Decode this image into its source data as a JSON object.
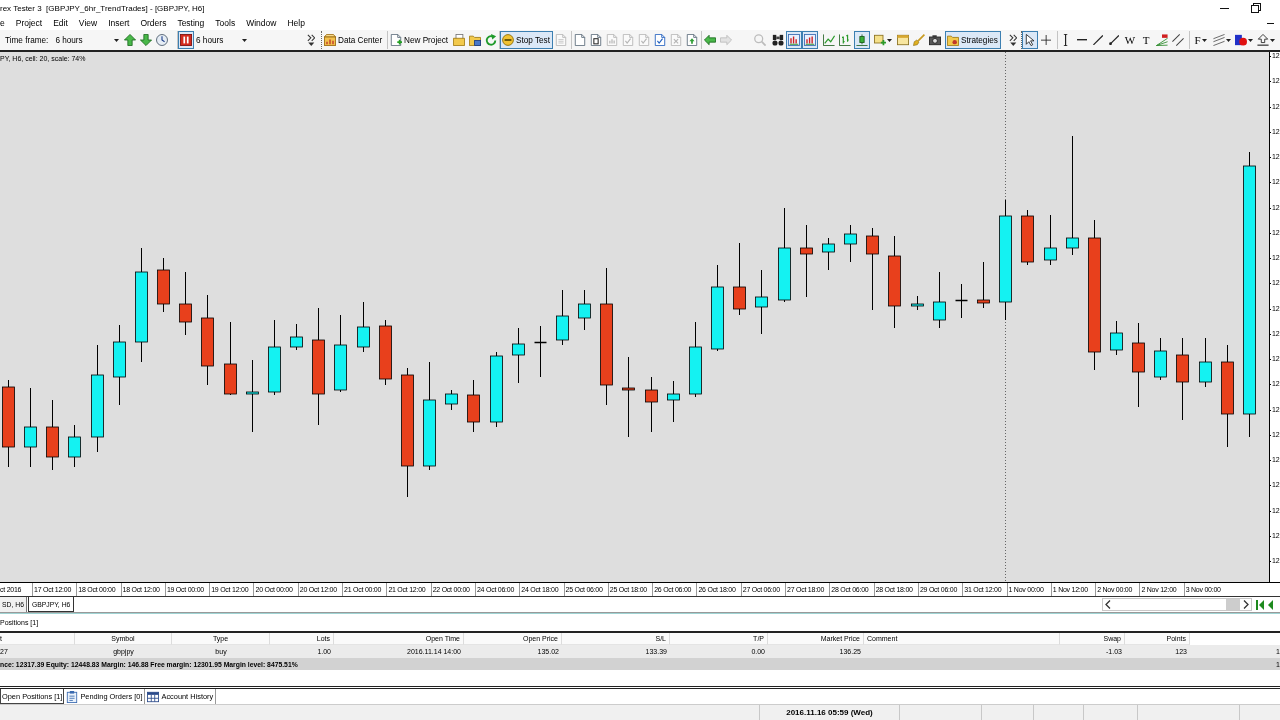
{
  "window": {
    "title": "rex Tester 3  [GBPJPY_6hr_TrendTrades] - [GBPJPY, H6]"
  },
  "menu": [
    "e",
    "Project",
    "Edit",
    "View",
    "Insert",
    "Orders",
    "Testing",
    "Tools",
    "Window",
    "Help"
  ],
  "toolbar": [
    [
      {
        "kind": "label",
        "text": "Time frame:"
      },
      {
        "kind": "dropdown",
        "value": "6 hours"
      },
      {
        "kind": "tool",
        "pressed": false,
        "disabled": false
      },
      {
        "kind": "tool",
        "pressed": false,
        "disabled": false
      },
      {
        "kind": "tool",
        "pressed": false,
        "disabled": false
      }
    ],
    [
      {
        "kind": "tool",
        "pressed": true,
        "disabled": false
      },
      {
        "kind": "dropdown",
        "value": "6 hours"
      }
    ],
    [
      {
        "kind": "tool",
        "pressed": false,
        "disabled": false
      }
    ],
    [
      {
        "kind": "button",
        "label": "Data Center",
        "pressed": false
      }
    ],
    [
      {
        "kind": "button",
        "label": "New Project",
        "pressed": false
      },
      {
        "kind": "tool",
        "pressed": false,
        "disabled": false
      },
      {
        "kind": "tool",
        "pressed": false,
        "disabled": false
      },
      {
        "kind": "tool",
        "pressed": false,
        "disabled": false
      }
    ],
    [
      {
        "kind": "button",
        "label": "Stop Test",
        "pressed": true
      },
      {
        "kind": "tool",
        "pressed": false,
        "disabled": true
      }
    ],
    [
      {
        "kind": "tool",
        "pressed": false,
        "disabled": false
      },
      {
        "kind": "tool",
        "pressed": false,
        "disabled": false
      },
      {
        "kind": "tool",
        "pressed": false,
        "disabled": true
      },
      {
        "kind": "tool",
        "pressed": false,
        "disabled": true
      },
      {
        "kind": "tool",
        "pressed": false,
        "disabled": true
      },
      {
        "kind": "tool",
        "pressed": false,
        "disabled": false
      },
      {
        "kind": "tool",
        "pressed": false,
        "disabled": true
      },
      {
        "kind": "tool",
        "pressed": false,
        "disabled": false
      }
    ],
    [
      {
        "kind": "tool",
        "pressed": false,
        "disabled": false
      },
      {
        "kind": "tool",
        "pressed": false,
        "disabled": true
      },
      {
        "kind": "tool",
        "pressed": false,
        "disabled": true
      },
      {
        "kind": "tool",
        "pressed": false,
        "disabled": false
      },
      {
        "kind": "tool",
        "pressed": true,
        "disabled": false
      },
      {
        "kind": "tool",
        "pressed": true,
        "disabled": false
      },
      {
        "kind": "tool",
        "pressed": false,
        "disabled": false
      },
      {
        "kind": "tool",
        "pressed": false,
        "disabled": false
      },
      {
        "kind": "tool",
        "pressed": true,
        "disabled": false
      },
      {
        "kind": "tool",
        "pressed": false,
        "disabled": false
      },
      {
        "kind": "tool",
        "pressed": false,
        "disabled": false
      },
      {
        "kind": "tool",
        "pressed": false,
        "disabled": false
      },
      {
        "kind": "tool",
        "pressed": false,
        "disabled": false
      }
    ],
    [
      {
        "kind": "button",
        "label": "Strategies",
        "pressed": true
      }
    ],
    [
      {
        "kind": "tool",
        "pressed": false,
        "disabled": false
      }
    ],
    [
      {
        "kind": "tool",
        "pressed": true,
        "disabled": false
      },
      {
        "kind": "tool",
        "pressed": false,
        "disabled": false
      }
    ],
    [
      {
        "kind": "tool",
        "pressed": false,
        "disabled": false
      },
      {
        "kind": "tool",
        "pressed": false,
        "disabled": false
      },
      {
        "kind": "tool",
        "pressed": false,
        "disabled": false
      },
      {
        "kind": "tool",
        "pressed": false,
        "disabled": false
      },
      {
        "kind": "glyph",
        "text": "W",
        "pressed": false
      },
      {
        "kind": "glyph",
        "text": "T",
        "pressed": false
      },
      {
        "kind": "tool",
        "pressed": false,
        "disabled": false
      },
      {
        "kind": "tool",
        "pressed": false,
        "disabled": false
      }
    ],
    [
      {
        "kind": "glyph",
        "text": "F",
        "pressed": false
      },
      {
        "kind": "tool",
        "pressed": false,
        "disabled": false
      },
      {
        "kind": "tool",
        "pressed": false,
        "disabled": false
      },
      {
        "kind": "tool",
        "pressed": false,
        "disabled": false
      }
    ]
  ],
  "chart": {
    "info": "PY, H6, cell: 20, scale: 74%",
    "price_axis": [
      "12",
      "12",
      "12",
      "12",
      "12",
      "12",
      "12",
      "12",
      "12",
      "12",
      "12",
      "12",
      "12",
      "12",
      "12",
      "12",
      "12",
      "12",
      "12",
      "12",
      "12"
    ],
    "time_axis": [
      "ct 2016",
      "17 Oct 12:00",
      "18 Oct 00:00",
      "18 Oct 12:00",
      "19 Oct 00:00",
      "19 Oct 12:00",
      "20 Oct 00:00",
      "20 Oct 12:00",
      "21 Oct 00:00",
      "21 Oct 12:00",
      "22 Oct 00:00",
      "24 Oct 06:00",
      "24 Oct 18:00",
      "25 Oct 06:00",
      "25 Oct 18:00",
      "26 Oct 06:00",
      "26 Oct 18:00",
      "27 Oct 06:00",
      "27 Oct 18:00",
      "28 Oct 06:00",
      "28 Oct 18:00",
      "29 Oct 06:00",
      "31 Oct 12:00",
      "1 Nov 00:00",
      "1 Nov 12:00",
      "2 Nov 00:00",
      "2 Nov 12:00",
      "3 Nov 00:00"
    ]
  },
  "chart_tabs": [
    {
      "label": "SD, H6",
      "selected": false
    },
    {
      "label": "GBPJPY, H6",
      "selected": true
    }
  ],
  "positions": {
    "title": "Positions [1]",
    "columns": {
      "column_1": "t",
      "symbol": "Symbol",
      "type": "Type",
      "lots": "Lots",
      "open_time": "Open Time",
      "open_price": "Open Price",
      "sl": "S/L",
      "tp": "T/P",
      "market_price": "Market Price",
      "comment": "Comment",
      "swap": "Swap",
      "points": "Points"
    },
    "rows": [
      {
        "column_1": "27",
        "symbol": "gbpjpy",
        "type": "buy",
        "lots": "1.00",
        "open_time": "2016.11.14 14:00",
        "open_price": "135.02",
        "sl": "133.39",
        "tp": "0.00",
        "market_price": "136.25",
        "swap": "-1.03",
        "points": "123",
        "column_13": "1"
      }
    ],
    "summary": {
      "text": "nce: 12317.39 Equity: 12448.83 Margin: 146.88 Free margin: 12301.95 Margin level: 8475.51%",
      "column_13": "1"
    }
  },
  "panel_tabs": [
    {
      "kind": "plain",
      "label": "Open Positions [1]",
      "selected": true
    },
    {
      "kind": "orders",
      "label": "Pending Orders [0]",
      "selected": false
    },
    {
      "kind": "history",
      "label": "Account History",
      "selected": false
    }
  ],
  "status_bar": {
    "time": "2016.11.16 05:59 (Wed)"
  }
}
